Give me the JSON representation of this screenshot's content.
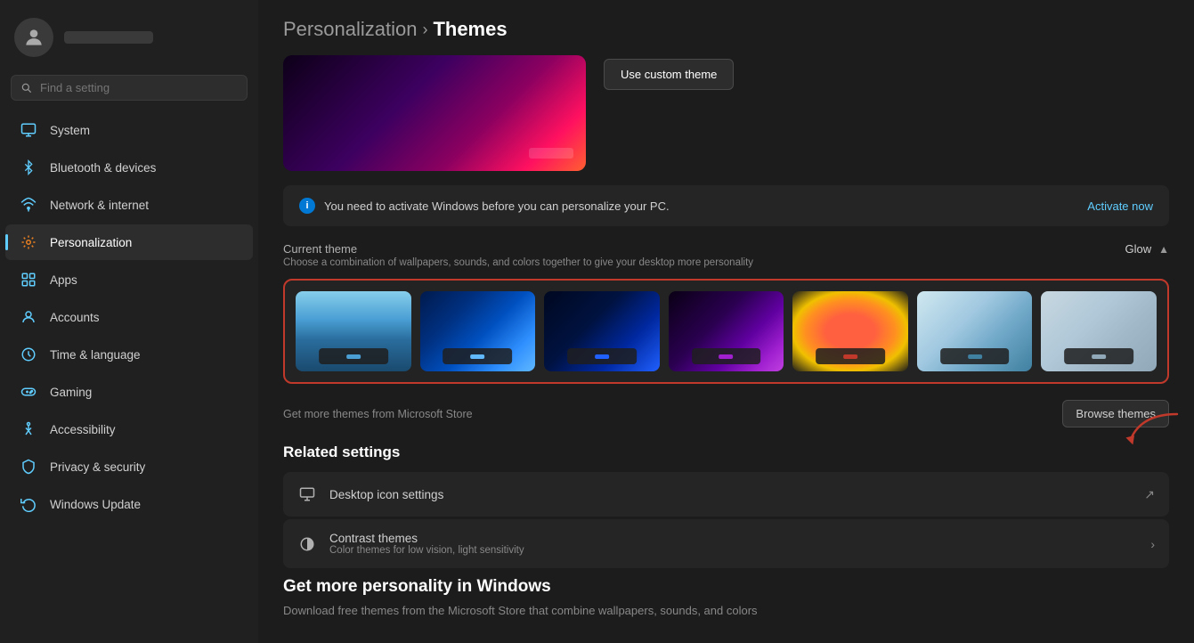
{
  "sidebar": {
    "username": "",
    "search_placeholder": "Find a setting",
    "items": [
      {
        "id": "system",
        "label": "System",
        "icon": "system",
        "color": "#0078d4",
        "active": false
      },
      {
        "id": "bluetooth",
        "label": "Bluetooth & devices",
        "icon": "bluetooth",
        "color": "#0078d4",
        "active": false
      },
      {
        "id": "network",
        "label": "Network & internet",
        "icon": "network",
        "color": "#0078d4",
        "active": false
      },
      {
        "id": "personalization",
        "label": "Personalization",
        "icon": "personalization",
        "color": "#e67e22",
        "active": true
      },
      {
        "id": "apps",
        "label": "Apps",
        "icon": "apps",
        "color": "#0078d4",
        "active": false
      },
      {
        "id": "accounts",
        "label": "Accounts",
        "icon": "accounts",
        "color": "#0078d4",
        "active": false
      },
      {
        "id": "time",
        "label": "Time & language",
        "icon": "time",
        "color": "#0078d4",
        "active": false
      },
      {
        "id": "gaming",
        "label": "Gaming",
        "icon": "gaming",
        "color": "#0078d4",
        "active": false
      },
      {
        "id": "accessibility",
        "label": "Accessibility",
        "icon": "accessibility",
        "color": "#0078d4",
        "active": false
      },
      {
        "id": "privacy",
        "label": "Privacy & security",
        "icon": "privacy",
        "color": "#0078d4",
        "active": false
      },
      {
        "id": "update",
        "label": "Windows Update",
        "icon": "update",
        "color": "#0078d4",
        "active": false
      }
    ]
  },
  "header": {
    "breadcrumb_parent": "Personalization",
    "breadcrumb_sep": "›",
    "breadcrumb_current": "Themes"
  },
  "theme_preview": {
    "use_custom_label": "Use custom theme"
  },
  "activation": {
    "icon": "i",
    "message": "You need to activate Windows before you can personalize your PC.",
    "link_label": "Activate now"
  },
  "current_theme": {
    "title": "Current theme",
    "description": "Choose a combination of wallpapers, sounds, and colors together to give your desktop more personality",
    "toggle_label": "Glow",
    "themes": [
      {
        "id": 1,
        "dot_color": "#4a9fd4",
        "bg": "beach"
      },
      {
        "id": 2,
        "dot_color": "#60b8ff",
        "bg": "win11blue"
      },
      {
        "id": 3,
        "dot_color": "#2060ff",
        "bg": "darkblue"
      },
      {
        "id": 4,
        "dot_color": "#a020d0",
        "bg": "purple"
      },
      {
        "id": 5,
        "dot_color": "#c0392b",
        "bg": "flower"
      },
      {
        "id": 6,
        "dot_color": "#4080a0",
        "bg": "light"
      },
      {
        "id": 7,
        "dot_color": "#90a8b8",
        "bg": "white"
      }
    ]
  },
  "browse": {
    "get_more_text": "Get more themes from Microsoft Store",
    "button_label": "Browse themes"
  },
  "related_settings": {
    "title": "Related settings",
    "items": [
      {
        "id": "desktop-icon",
        "label": "Desktop icon settings",
        "sublabel": "",
        "icon": "monitor",
        "arrow": "external"
      },
      {
        "id": "contrast",
        "label": "Contrast themes",
        "sublabel": "Color themes for low vision, light sensitivity",
        "icon": "contrast",
        "arrow": "chevron"
      }
    ]
  },
  "personality": {
    "title": "Get more personality in Windows",
    "description": "Download free themes from the Microsoft Store that combine wallpapers, sounds, and colors"
  }
}
